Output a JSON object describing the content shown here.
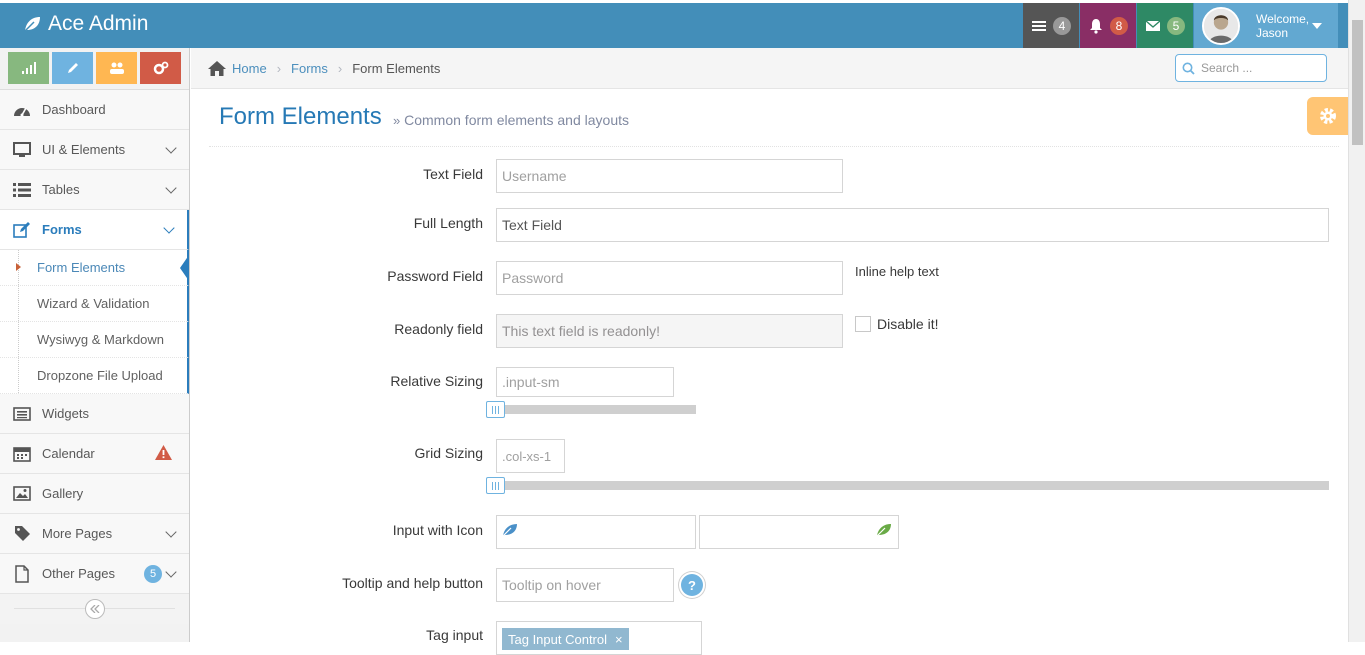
{
  "navbar": {
    "brand": "Ace Admin",
    "tasks_count": "4",
    "notifications_count": "8",
    "messages_count": "5",
    "welcome_line1": "Welcome,",
    "welcome_line2": "Jason"
  },
  "sidebar": {
    "shortcuts": [
      "signal-icon",
      "pencil-icon",
      "users-icon",
      "cogs-icon"
    ],
    "items": [
      {
        "label": "Dashboard",
        "icon": "tachometer-icon"
      },
      {
        "label": "UI & Elements",
        "icon": "desktop-icon"
      },
      {
        "label": "Tables",
        "icon": "list-icon"
      },
      {
        "label": "Forms",
        "icon": "pencil-square-icon"
      },
      {
        "label": "Widgets",
        "icon": "list-alt-icon"
      },
      {
        "label": "Calendar",
        "icon": "calendar-icon"
      },
      {
        "label": "Gallery",
        "icon": "picture-icon"
      },
      {
        "label": "More Pages",
        "icon": "tag-icon"
      },
      {
        "label": "Other Pages",
        "icon": "file-icon",
        "badge": "5"
      }
    ],
    "forms_sub": [
      "Form Elements",
      "Wizard & Validation",
      "Wysiwyg & Markdown",
      "Dropzone File Upload"
    ]
  },
  "breadcrumb": {
    "home": "Home",
    "forms": "Forms",
    "current": "Form Elements",
    "search_placeholder": "Search ..."
  },
  "page": {
    "title": "Form Elements",
    "subtitle": "Common form elements and layouts"
  },
  "form": {
    "text_field_label": "Text Field",
    "text_field_placeholder": "Username",
    "full_length_label": "Full Length",
    "full_length_value": "Text Field",
    "password_label": "Password Field",
    "password_placeholder": "Password",
    "inline_help": "Inline help text",
    "readonly_label": "Readonly field",
    "readonly_value": "This text field is readonly!",
    "disable_it": "Disable it!",
    "relative_sizing_label": "Relative Sizing",
    "relative_sizing_placeholder": ".input-sm",
    "grid_sizing_label": "Grid Sizing",
    "grid_sizing_placeholder": ".col-xs-1",
    "input_icon_label": "Input with Icon",
    "tooltip_label": "Tooltip and help button",
    "tooltip_placeholder": "Tooltip on hover",
    "help_symbol": "?",
    "tag_input_label": "Tag input",
    "tag_value": "Tag Input Control"
  },
  "colors": {
    "navbar": "#438eb9",
    "accent": "#2b7dbc",
    "warning": "#ffb752",
    "danger": "#d15b47",
    "success": "#87b87f"
  }
}
